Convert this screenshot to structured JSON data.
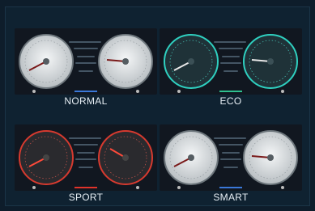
{
  "modes": [
    {
      "label": "NORMAL",
      "accent": "#3a78d8",
      "dial": "#dfe3e6",
      "rim": "#9aa4ab",
      "needle": "#8a1a1a",
      "bar_color": "#3a78d8"
    },
    {
      "label": "ECO",
      "accent": "#2fd0c0",
      "dial": "#23363c",
      "rim": "#2fd0c0",
      "needle": "#e8e8e8",
      "bar_color": "#2fbf8f"
    },
    {
      "label": "SPORT",
      "accent": "#e0332a",
      "dial": "#2a2a2e",
      "rim": "#d63a2f",
      "needle": "#ff4a3a",
      "bar_color": "#e0332a"
    },
    {
      "label": "SMART",
      "accent": "#3a78d8",
      "dial": "#dfe3e6",
      "rim": "#9aa4ab",
      "needle": "#8a1a1a",
      "bar_color": "#3a78d8"
    }
  ]
}
